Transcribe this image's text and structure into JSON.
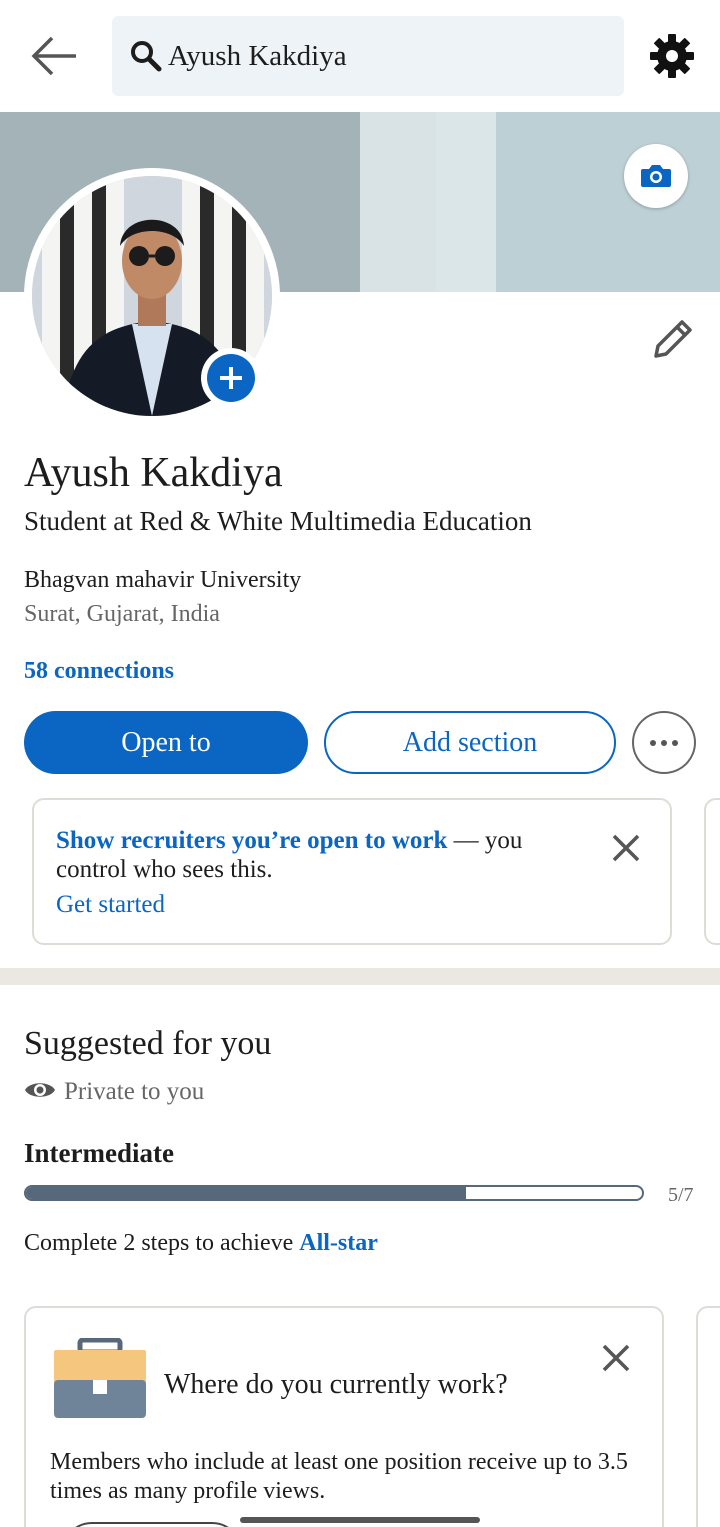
{
  "search": {
    "query": "Ayush Kakdiya"
  },
  "profile": {
    "name": "Ayush Kakdiya",
    "headline": "Student at Red & White Multimedia Education",
    "university": "Bhagvan mahavir University",
    "location": "Surat, Gujarat, India",
    "connections": "58 connections"
  },
  "actions": {
    "open_to": "Open to",
    "add_section": "Add section"
  },
  "open_to_work_card": {
    "link_text": "Show recruiters you’re open to work",
    "rest_text": " — you control who sees this.",
    "cta": "Get started"
  },
  "suggested": {
    "title": "Suggested for you",
    "private_label": "Private to you",
    "level": "Intermediate",
    "progress_count": "5/7",
    "progress_fraction": 0.714,
    "complete_prefix": "Complete 2 steps to achieve ",
    "complete_link": "All-star"
  },
  "work_card": {
    "question": "Where do you currently work?",
    "description": "Members who include at least one position receive up to 3.5 times as many profile views."
  },
  "colors": {
    "accent": "#0a66c2",
    "progress": "#56687a",
    "divider": "#ebe8e2"
  },
  "icons": [
    "back-arrow-icon",
    "search-icon",
    "gear-icon",
    "camera-icon",
    "plus-icon",
    "pencil-icon",
    "more-icon",
    "close-icon",
    "eye-icon",
    "briefcase-icon"
  ]
}
